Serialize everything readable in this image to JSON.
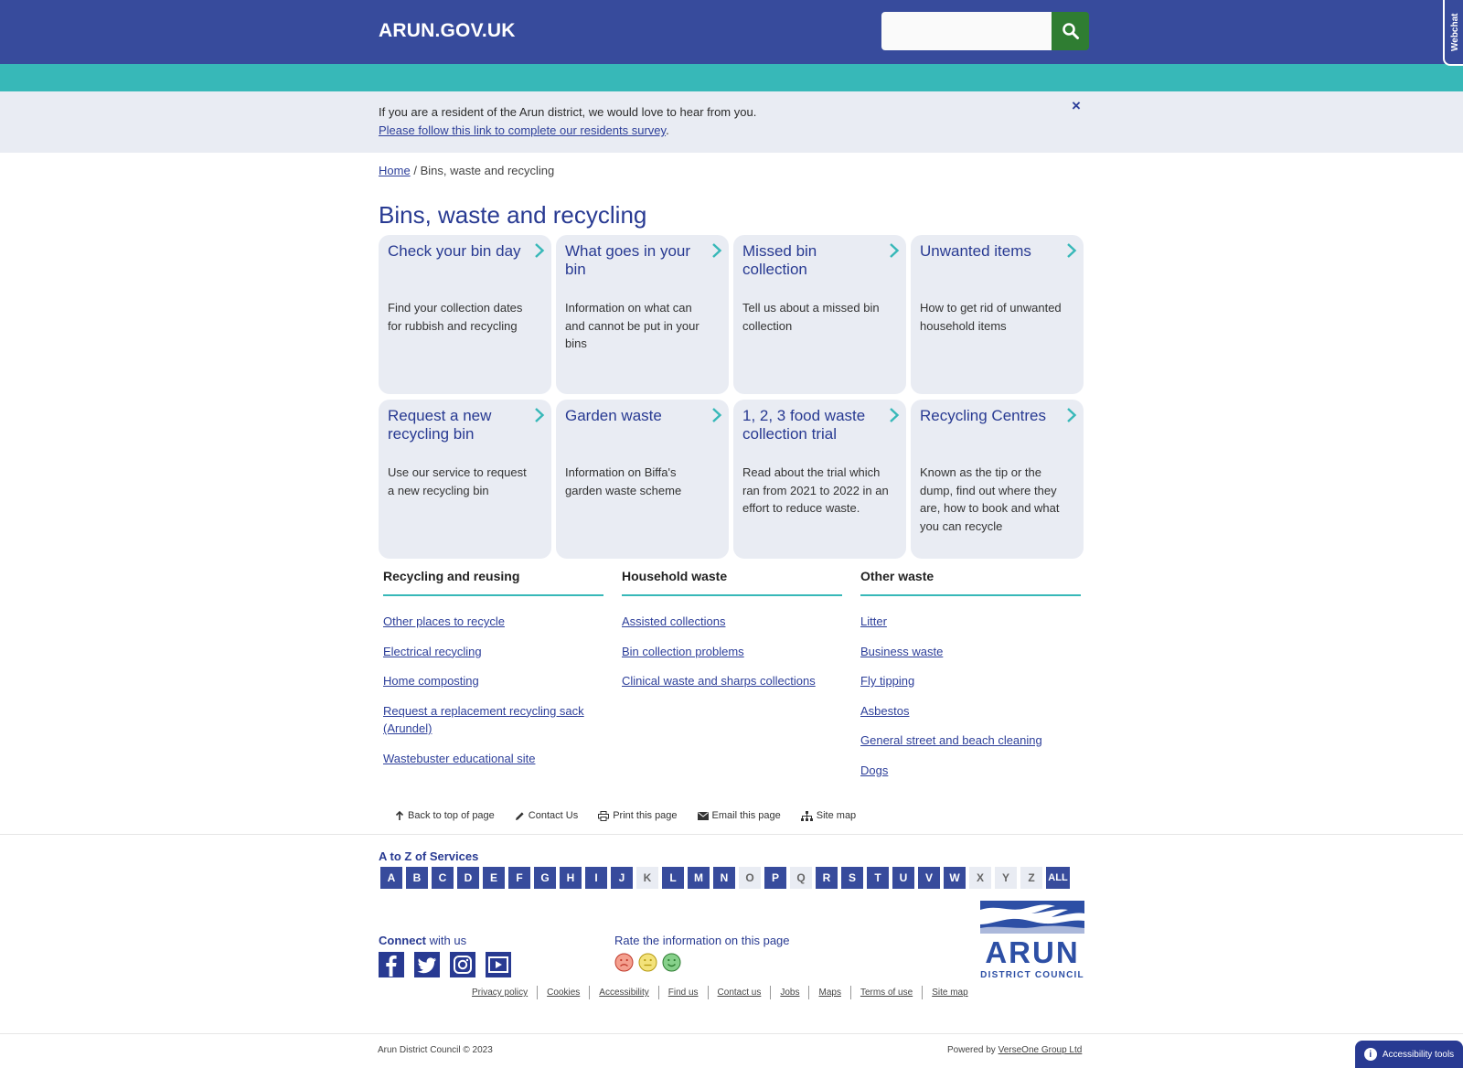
{
  "header": {
    "logo": "ARUN.GOV.UK",
    "search_placeholder": "",
    "webchat_label": "Webchat",
    "background_color": "#374b9c",
    "search_button_color": "#2f7d32"
  },
  "accent_color": "#37b8b8",
  "banner": {
    "text": "If you are a resident of the Arun district, we would love to hear from you.",
    "link_text": "Please follow this link to complete our residents survey",
    "link_suffix": ".",
    "close_label": "×"
  },
  "breadcrumb": {
    "home": "Home",
    "separator": "/",
    "current": "Bins, waste and recycling"
  },
  "page_title": "Bins, waste and recycling",
  "cards": [
    {
      "title": "Check your bin day",
      "desc": "Find your collection dates for rubbish and recycling"
    },
    {
      "title": "What goes in your bin",
      "desc": "Information on what can and cannot be put in your bins"
    },
    {
      "title": "Missed bin collection",
      "desc": "Tell us about a missed bin collection"
    },
    {
      "title": "Unwanted items",
      "desc": "How to get rid of unwanted household items"
    },
    {
      "title": "Request a new recycling bin",
      "desc": "Use our service to request a new recycling bin"
    },
    {
      "title": "Garden waste",
      "desc": "Information on Biffa's garden waste scheme"
    },
    {
      "title": "1, 2, 3 food waste collection trial",
      "desc": "Read about the trial which ran from 2021 to 2022 in an effort to reduce waste."
    },
    {
      "title": "Recycling Centres",
      "desc": "Known as the tip or the dump, find out where they are, how to book and what you can recycle"
    }
  ],
  "link_columns": [
    {
      "title": "Recycling and reusing",
      "links": [
        "Other places to recycle",
        "Electrical recycling",
        "Home composting",
        "Request a replacement recycling sack (Arundel)",
        "Wastebuster educational site"
      ]
    },
    {
      "title": "Household waste",
      "links": [
        "Assisted collections",
        "Bin collection problems",
        "Clinical waste and sharps collections"
      ]
    },
    {
      "title": "Other waste",
      "links": [
        "Litter",
        "Business waste",
        "Fly tipping",
        "Asbestos",
        "General street and beach cleaning",
        "Dogs"
      ]
    }
  ],
  "utilities": {
    "back_to_top": "Back to top of page",
    "contact": "Contact Us",
    "print": "Print this page",
    "email": "Email this page",
    "sitemap": "Site map"
  },
  "az": {
    "title": "A to Z of Services",
    "letters": [
      {
        "l": "A",
        "on": true
      },
      {
        "l": "B",
        "on": true
      },
      {
        "l": "C",
        "on": true
      },
      {
        "l": "D",
        "on": true
      },
      {
        "l": "E",
        "on": true
      },
      {
        "l": "F",
        "on": true
      },
      {
        "l": "G",
        "on": true
      },
      {
        "l": "H",
        "on": true
      },
      {
        "l": "I",
        "on": true
      },
      {
        "l": "J",
        "on": true
      },
      {
        "l": "K",
        "on": false
      },
      {
        "l": "L",
        "on": true
      },
      {
        "l": "M",
        "on": true
      },
      {
        "l": "N",
        "on": true
      },
      {
        "l": "O",
        "on": false
      },
      {
        "l": "P",
        "on": true
      },
      {
        "l": "Q",
        "on": false
      },
      {
        "l": "R",
        "on": true
      },
      {
        "l": "S",
        "on": true
      },
      {
        "l": "T",
        "on": true
      },
      {
        "l": "U",
        "on": true
      },
      {
        "l": "V",
        "on": true
      },
      {
        "l": "W",
        "on": true
      },
      {
        "l": "X",
        "on": false
      },
      {
        "l": "Y",
        "on": false
      },
      {
        "l": "Z",
        "on": false
      }
    ],
    "all_label": "ALL"
  },
  "connect": {
    "bold": "Connect",
    "rest": " with us",
    "icons": [
      "facebook-icon",
      "twitter-icon",
      "instagram-icon",
      "youtube-icon"
    ]
  },
  "rating": {
    "label": "Rate the information on this page",
    "faces": [
      {
        "name": "sad-face-icon",
        "color": "#f4a08f"
      },
      {
        "name": "neutral-face-icon",
        "color": "#f3e27a"
      },
      {
        "name": "happy-face-icon",
        "color": "#86d08a"
      }
    ]
  },
  "council_logo": {
    "name": "ARUN",
    "sub": "DISTRICT COUNCIL"
  },
  "footer_links": [
    "Privacy policy",
    "Cookies",
    "Accessibility",
    "Find us",
    "Contact us",
    "Jobs",
    "Maps",
    "Terms of use",
    "Site map"
  ],
  "copyright": "Arun District Council © 2023",
  "powered_by": {
    "prefix": "Powered by ",
    "link": "VerseOne Group Ltd"
  },
  "accessibility_tools": "Accessibility tools"
}
